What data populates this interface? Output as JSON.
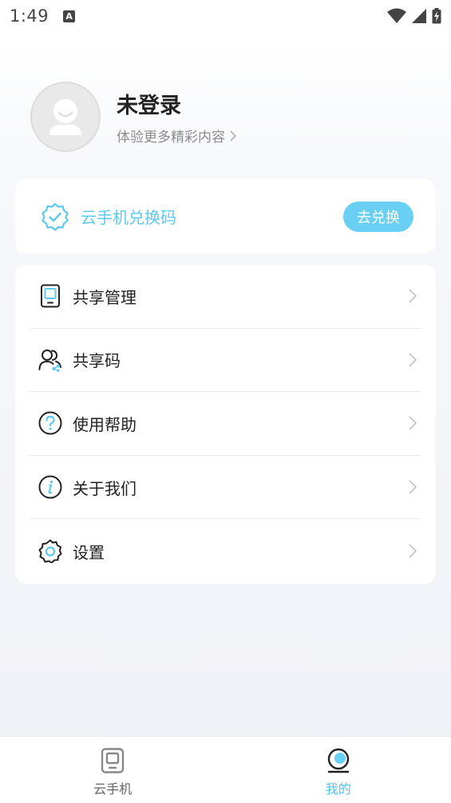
{
  "status_bar": {
    "time": "1:49",
    "notification_badge": "A"
  },
  "profile": {
    "name": "未登录",
    "subtitle": "体验更多精彩内容"
  },
  "redeem": {
    "label": "云手机兑换码",
    "button_label": "去兑换"
  },
  "menu": {
    "items": [
      {
        "label": "共享管理",
        "icon": "tablet-icon"
      },
      {
        "label": "共享码",
        "icon": "users-share-icon"
      },
      {
        "label": "使用帮助",
        "icon": "help-icon"
      },
      {
        "label": "关于我们",
        "icon": "info-icon"
      },
      {
        "label": "设置",
        "icon": "gear-icon"
      }
    ]
  },
  "bottom_nav": {
    "tabs": [
      {
        "label": "云手机",
        "icon": "tablet-icon",
        "active": false
      },
      {
        "label": "我的",
        "icon": "profile-icon",
        "active": true
      }
    ]
  },
  "colors": {
    "accent": "#69d0f3",
    "accent_text": "#5ec9ee",
    "text_primary": "#222222",
    "text_secondary": "#8c8c8c"
  }
}
